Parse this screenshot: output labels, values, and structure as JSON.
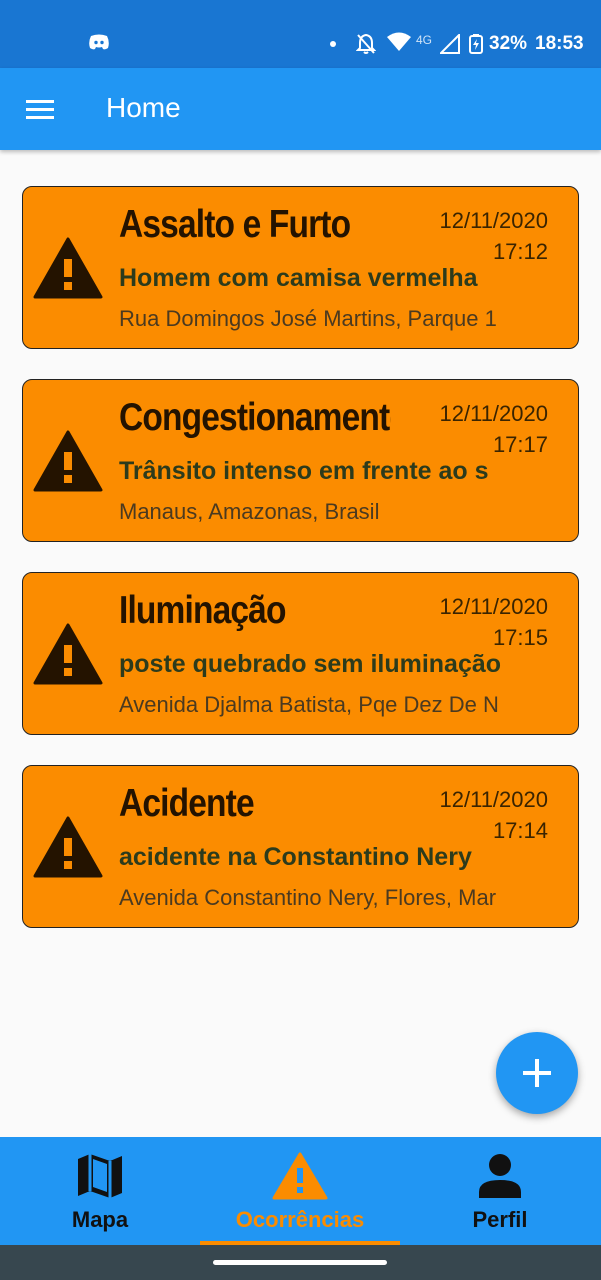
{
  "status_bar": {
    "network": "4G",
    "battery_pct": "32%",
    "time": "18:53",
    "icons": [
      "discord-icon",
      "notification-dot",
      "bell-off-icon",
      "wifi-icon",
      "signal-icon",
      "battery-icon"
    ]
  },
  "app_bar": {
    "title": "Home",
    "menu_icon": "menu-icon"
  },
  "occurrences": [
    {
      "title": "Assalto e Furto",
      "date": "12/11/2020",
      "time": "17:12",
      "description": "Homem com camisa vermelha",
      "address": "Rua Domingos José Martins, Parque 1",
      "icon": "warning-icon"
    },
    {
      "title": "Congestionamento",
      "date": "12/11/2020",
      "time": "17:17",
      "description": "Trânsito intenso em frente ao s",
      "address": "Manaus, Amazonas, Brasil",
      "icon": "warning-icon"
    },
    {
      "title": "Iluminação",
      "date": "12/11/2020",
      "time": "17:15",
      "description": "poste quebrado sem iluminação",
      "address": "Avenida Djalma Batista, Pqe Dez De N",
      "icon": "warning-icon"
    },
    {
      "title": "Acidente",
      "date": "12/11/2020",
      "time": "17:14",
      "description": "acidente na Constantino Nery",
      "address": "Avenida Constantino Nery, Flores, Mar",
      "icon": "warning-icon"
    }
  ],
  "fab": {
    "icon": "plus-icon"
  },
  "bottom_nav": {
    "items": [
      {
        "label": "Mapa",
        "icon": "map-icon",
        "active": false
      },
      {
        "label": "Ocorrências",
        "icon": "warning-icon",
        "active": true
      },
      {
        "label": "Perfil",
        "icon": "person-icon",
        "active": false
      }
    ]
  },
  "colors": {
    "status_bar": "#1976d2",
    "primary": "#2196f3",
    "accent": "#fb8c00",
    "background": "#fafafa",
    "system_nav": "#37474f"
  }
}
